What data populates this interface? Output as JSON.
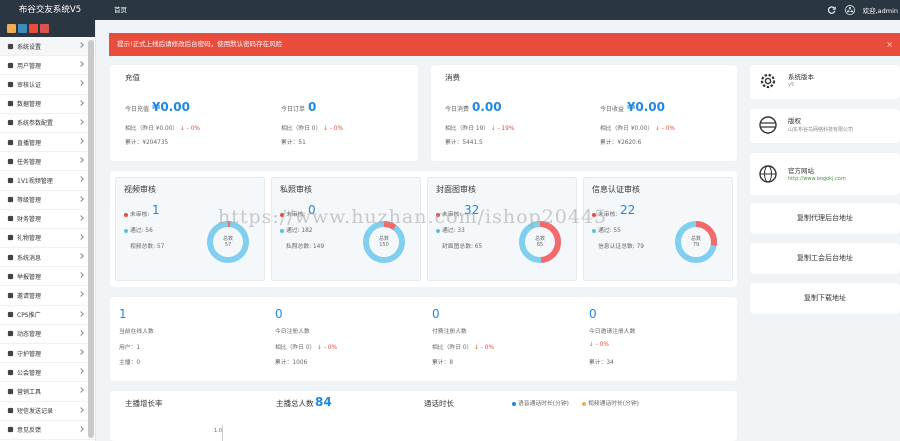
{
  "app": {
    "brand": "布谷交友系统V5",
    "nav_home": "首页",
    "user": "欢迎,admin"
  },
  "alert": {
    "text": "提示!正式上线后请修改后台密码，使用默认密码存在风险",
    "close": "×"
  },
  "sidebar": {
    "items": [
      {
        "label": "系统设置",
        "icon": "gear-icon"
      },
      {
        "label": "用户管理",
        "icon": "user-icon"
      },
      {
        "label": "审核认证",
        "icon": "check-icon"
      },
      {
        "label": "数据管理",
        "icon": "grid-icon"
      },
      {
        "label": "系统参数配置",
        "icon": "grid-icon"
      },
      {
        "label": "直播管理",
        "icon": "video-icon"
      },
      {
        "label": "任务管理",
        "icon": "task-icon"
      },
      {
        "label": "1V1视频管理",
        "icon": "phone-icon"
      },
      {
        "label": "等级管理",
        "icon": "level-icon"
      },
      {
        "label": "财务管理",
        "icon": "money-icon"
      },
      {
        "label": "礼物管理",
        "icon": "gift-icon"
      },
      {
        "label": "系统消息",
        "icon": "bell-icon"
      },
      {
        "label": "举报管理",
        "icon": "flag-icon"
      },
      {
        "label": "邀请管理",
        "icon": "invite-icon"
      },
      {
        "label": "CPS推广",
        "icon": "cps-icon"
      },
      {
        "label": "动态管理",
        "icon": "bulb-icon"
      },
      {
        "label": "守护管理",
        "icon": "shield-icon"
      },
      {
        "label": "公会管理",
        "icon": "guild-icon"
      },
      {
        "label": "营销工具",
        "icon": "tool-icon"
      },
      {
        "label": "短信发送记录",
        "icon": "sms-icon"
      },
      {
        "label": "意见反馈",
        "icon": "feedback-icon"
      }
    ]
  },
  "recharge": {
    "title": "充值",
    "today_recharge_label": "今日充值",
    "today_recharge": "¥0.00",
    "today_orders_label": "今日订单",
    "today_orders": "0",
    "cmp1": "相比（昨日 ¥0.00）",
    "cmp1_change": "↓ - 0%",
    "cmp2": "相比（昨日 0）",
    "cmp2_change": "↓ - 0%",
    "total1": "累计：¥204735",
    "total2": "累计：51"
  },
  "consume": {
    "title": "消费",
    "today_consume_label": "今日消费",
    "today_consume": "0.00",
    "today_income_label": "今日收益",
    "today_income": "¥0.00",
    "cmp1": "相比（昨日 19）",
    "cmp1_change": "↓ - 19%",
    "cmp2": "相比（昨日 ¥0.00）",
    "cmp2_change": "↓ - 0%",
    "total1": "累计：5441.5",
    "total2": "累计：¥2620.6"
  },
  "reviews": [
    {
      "title": "视频审核",
      "pending_label": "未审核:",
      "pending": "1",
      "passed": "通过: 56",
      "total": "视频总数: 57",
      "center_label": "总数",
      "center_value": "57",
      "pct": 2
    },
    {
      "title": "私照审核",
      "pending_label": "未审核:",
      "pending": "0",
      "passed": "通过: 182",
      "total": "私照总数: 149",
      "center_label": "总数",
      "center_value": "150",
      "pct": 10
    },
    {
      "title": "封面图审核",
      "pending_label": "未审核:",
      "pending": "32",
      "passed": "通过: 33",
      "total": "封面图总数: 65",
      "center_label": "总数",
      "center_value": "65",
      "pct": 49
    },
    {
      "title": "信息认证审核",
      "pending_label": "未审核:",
      "pending": "22",
      "passed": "通过: 55",
      "total": "信息认证总数: 79",
      "center_label": "总数",
      "center_value": "79",
      "pct": 28
    }
  ],
  "stats": [
    {
      "value": "1",
      "label": "当前在线人数",
      "line1": "用户：1",
      "line2": "主播：0",
      "change": ""
    },
    {
      "value": "0",
      "label": "今日注册人数",
      "line1": "相比（昨日 0）",
      "line2": "累计：1006",
      "change": "↓ - 0%"
    },
    {
      "value": "0",
      "label": "付费注册人数",
      "line1": "相比（昨日 0）",
      "line2": "累计：8",
      "change": "↓ - 0%"
    },
    {
      "value": "0",
      "label": "今日邀请注册人数",
      "line1": "",
      "line2": "累计：34",
      "change": "↓ - 0%"
    }
  ],
  "bottom": {
    "growth_label": "主播增长率",
    "anchors_label": "主播总人数",
    "anchors_value": "84",
    "duration_label": "通话时长",
    "legend1": "语音通话时长(分钟)",
    "legend2": "视频通话时长(分钟)",
    "axis_tick": "1.0"
  },
  "right": {
    "version_title": "系统版本",
    "version_value": "v5",
    "copyright_title": "版权",
    "copyright_value": "山东布谷鸟网络科技有限公司",
    "site_title": "官方网站",
    "site_value": "http://www.bogokj.com",
    "btn1": "复制代理后台地址",
    "btn2": "复制工会后台地址",
    "btn3": "复制下载地址"
  },
  "watermark": "https://www.huzhan.com/ishop20445",
  "colors": {
    "accent": "#1e88e5",
    "pending": "#e74c3c",
    "passed": "#5bc0de",
    "donut_main": "#81cfef",
    "donut_fail": "#f46a6a",
    "alert": "#e74c3c",
    "topbar": "#2b3643"
  }
}
